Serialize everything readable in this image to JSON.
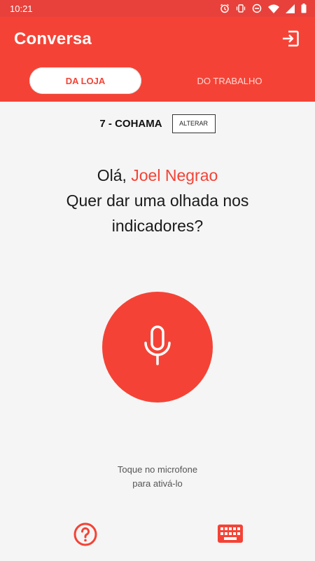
{
  "status_bar": {
    "time": "10:21",
    "icons": [
      "alarm-icon",
      "vibrate-icon",
      "do-not-disturb-icon",
      "wifi-icon",
      "signal-icon",
      "battery-icon"
    ]
  },
  "header": {
    "title": "Conversa",
    "logout_icon": "logout-icon",
    "tabs": [
      {
        "label": "DA LOJA",
        "active": true
      },
      {
        "label": "DO TRABALHO",
        "active": false
      }
    ]
  },
  "store": {
    "name": "7 - COHAMA",
    "change_label": "ALTERAR"
  },
  "greeting": {
    "prefix": "Olá, ",
    "user_name": "Joel Negrao",
    "line2": "Quer dar uma olhada nos",
    "line3": "indicadores?"
  },
  "mic": {
    "icon": "microphone-icon",
    "hint_line1": "Toque no microfone",
    "hint_line2": "para ativá-lo"
  },
  "bottom": {
    "help_icon": "help-icon",
    "keyboard_icon": "keyboard-icon"
  },
  "colors": {
    "primary": "#f44336",
    "status_bar": "#e8413b",
    "background": "#f5f5f5"
  }
}
